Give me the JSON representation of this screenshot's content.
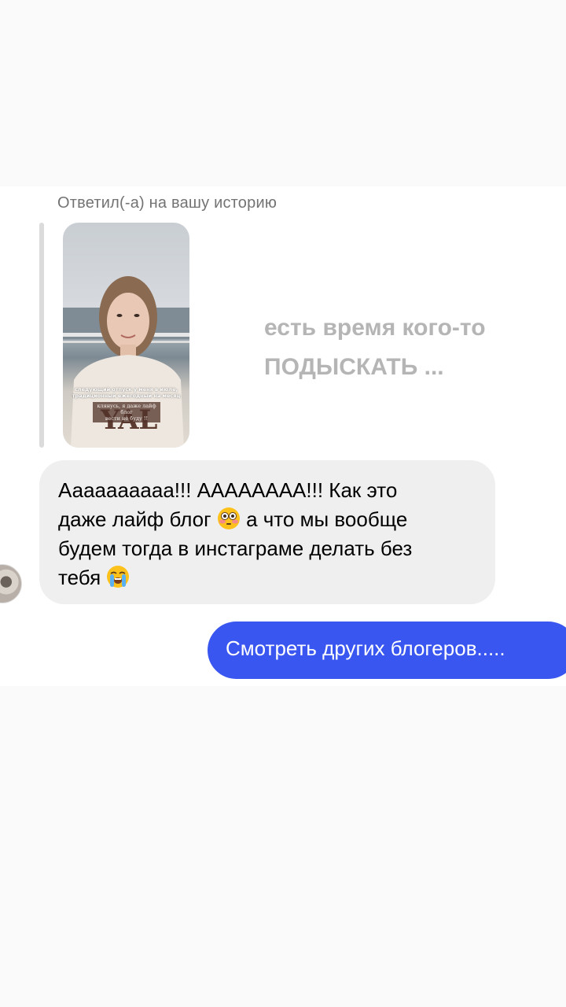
{
  "conversation": {
    "reply_label": "Ответил(-а) на вашу историю",
    "story": {
      "overlay_line1": "есть время кого-то",
      "overlay_line2": "ПОДЫСКАТЬ ...",
      "caption_line1": "следующий отпуск у меня в июле,",
      "caption_line2": "традиционный ежегодный на месяц",
      "caption_line3": "клянусь, я даже лайф блог",
      "caption_line4": "вести не буду !!"
    },
    "incoming_message": {
      "line1": "Аааааааааа!!! АААААААА!!! Как это",
      "line2_before_emoji": "даже лайф блог",
      "emoji1": "flushed-face-emoji",
      "line2_after_emoji": "а что мы вообще",
      "line3": "будем тогда в инстаграме делать без",
      "line4_before_emoji": "тебя",
      "emoji2": "loudly-crying-face-emoji"
    },
    "outgoing_message": {
      "text": "Смотреть других блогеров....."
    },
    "colors": {
      "outgoing_bubble": "#3a56f0",
      "incoming_bubble": "#efefef",
      "meta_text": "#737373"
    }
  }
}
